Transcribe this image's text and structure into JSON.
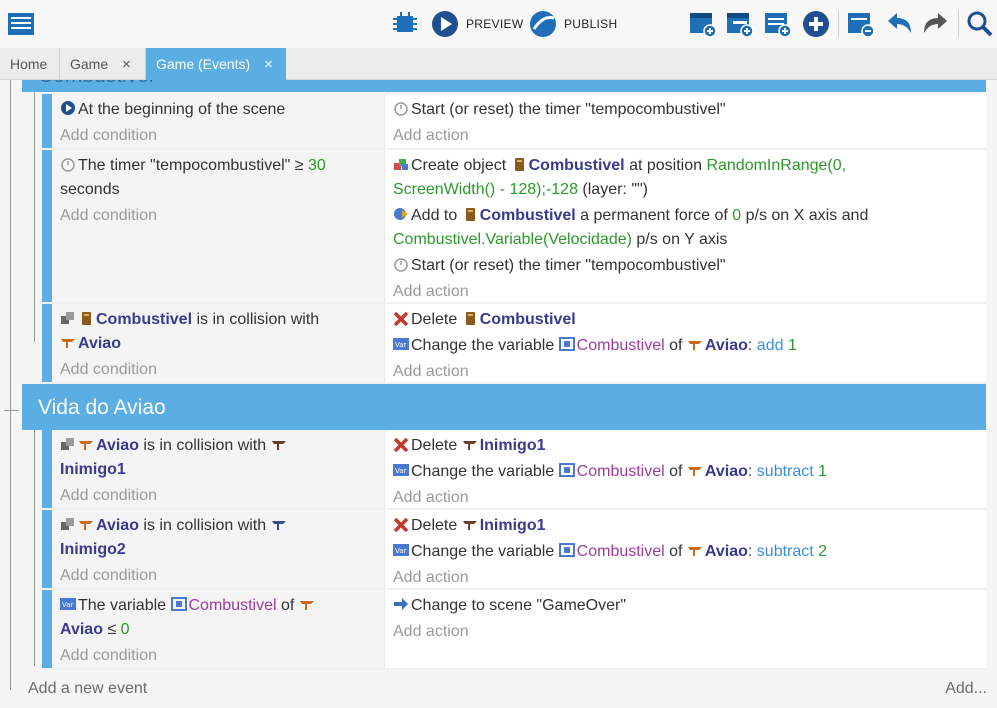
{
  "toolbar": {
    "preview_label": "PREVIEW",
    "publish_label": "PUBLISH",
    "accent": "#1e6fb5"
  },
  "tabs": [
    {
      "label": "Home"
    },
    {
      "label": "Game",
      "close": "×"
    },
    {
      "label": "Game (Events)",
      "close": "×"
    }
  ],
  "colors": {
    "group_bar": "#5aaee3",
    "object": "#3a3a8e",
    "number": "#2a9a2a",
    "variable": "#9b3d9b",
    "operator": "#3b8ed8"
  },
  "group_top": {
    "title": "Combustivel"
  },
  "events_top": [
    {
      "conditions": [
        [
          "At the beginning of the scene"
        ]
      ],
      "add_condition": "Add condition",
      "actions": [
        [
          "Start (or reset) the timer ",
          "\"tempocombustivel\""
        ]
      ],
      "add_action": "Add action"
    },
    {
      "cond_text": [
        "The timer \"tempocombustivel\" ",
        "≥",
        "30",
        "seconds"
      ],
      "add_condition": "Add condition",
      "create": [
        "Create object ",
        "Combustivel",
        " at position ",
        "RandomInRange(0,",
        "ScreenWidth() - 128);-128",
        " (layer: \"\")"
      ],
      "force": [
        "Add to ",
        "Combustivel",
        " a permanent force of ",
        "0",
        " p/s on X axis and",
        "Combustivel.Variable(Velocidade)",
        " p/s on Y axis"
      ],
      "timer": [
        "Start (or reset) the timer ",
        "\"tempocombustivel\""
      ],
      "add_action": "Add action"
    },
    {
      "cond": [
        "Combustivel",
        " is in collision with",
        "Aviao"
      ],
      "add_condition": "Add condition",
      "delete": [
        "Delete ",
        "Combustivel"
      ],
      "change": [
        "Change the variable ",
        "Combustivel",
        " of ",
        "Aviao",
        ": ",
        "add",
        "1"
      ],
      "add_action": "Add action"
    }
  ],
  "group_vida": {
    "title": "Vida do Aviao"
  },
  "events_vida": [
    {
      "cond": [
        "Aviao",
        " is in collision with",
        "Inimigo1"
      ],
      "add_condition": "Add condition",
      "delete": [
        "Delete ",
        "Inimigo1"
      ],
      "change": [
        "Change the variable ",
        "Combustivel",
        " of ",
        "Aviao",
        ": ",
        "subtract",
        "1"
      ],
      "add_action": "Add action"
    },
    {
      "cond": [
        "Aviao",
        " is in collision with",
        "Inimigo2"
      ],
      "add_condition": "Add condition",
      "delete": [
        "Delete ",
        "Inimigo1"
      ],
      "change": [
        "Change the variable ",
        "Combustivel",
        " of ",
        "Aviao",
        ": ",
        "subtract",
        "2"
      ],
      "add_action": "Add action"
    },
    {
      "cond": [
        "The variable ",
        "Combustivel",
        " of ",
        "Aviao",
        "≤",
        "0"
      ],
      "add_condition": "Add condition",
      "scene": [
        "Change to scene ",
        "\"GameOver\""
      ],
      "add_action": "Add action"
    }
  ],
  "footer": {
    "add_event": "Add a new event",
    "add_more": "Add..."
  }
}
